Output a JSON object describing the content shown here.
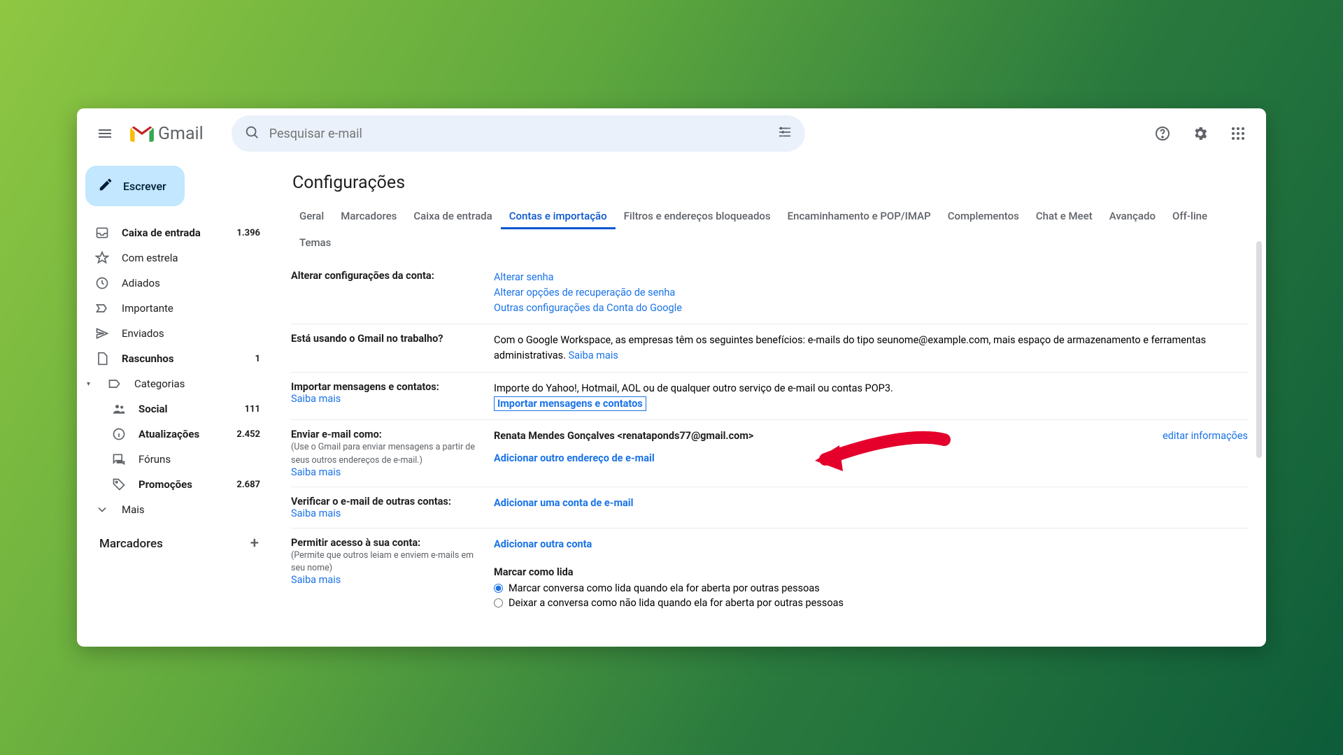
{
  "brand": {
    "name": "Gmail"
  },
  "search": {
    "placeholder": "Pesquisar e-mail"
  },
  "compose": {
    "label": "Escrever"
  },
  "nav": {
    "inbox": {
      "label": "Caixa de entrada",
      "count": "1.396"
    },
    "starred": {
      "label": "Com estrela"
    },
    "snoozed": {
      "label": "Adiados"
    },
    "important": {
      "label": "Importante"
    },
    "sent": {
      "label": "Enviados"
    },
    "drafts": {
      "label": "Rascunhos",
      "count": "1"
    },
    "categories": {
      "label": "Categorias"
    },
    "social": {
      "label": "Social",
      "count": "111"
    },
    "updates": {
      "label": "Atualizações",
      "count": "2.452"
    },
    "forums": {
      "label": "Fóruns"
    },
    "promos": {
      "label": "Promoções",
      "count": "2.687"
    },
    "more": {
      "label": "Mais"
    }
  },
  "labels": {
    "header": "Marcadores"
  },
  "page": {
    "title": "Configurações"
  },
  "tabs": {
    "general": "Geral",
    "labels": "Marcadores",
    "inbox": "Caixa de entrada",
    "accounts": "Contas e importação",
    "filters": "Filtros e endereços bloqueados",
    "forwarding": "Encaminhamento e POP/IMAP",
    "addons": "Complementos",
    "chat": "Chat e Meet",
    "advanced": "Avançado",
    "offline": "Off-line",
    "themes": "Temas"
  },
  "sections": {
    "acct": {
      "title": "Alterar configurações da conta:",
      "l1": "Alterar senha",
      "l2": "Alterar opções de recuperação de senha",
      "l3": "Outras configurações da Conta do Google"
    },
    "work": {
      "title": "Está usando o Gmail no trabalho?",
      "text": "Com o Google Workspace, as empresas têm os seguintes benefícios: e-mails do tipo seunome@example.com, mais espaço de armazenamento e ferramentas administrativas. ",
      "more": "Saiba mais"
    },
    "import": {
      "title": "Importar mensagens e contatos:",
      "more": "Saiba mais",
      "text": "Importe do Yahoo!, Hotmail, AOL ou de qualquer outro serviço de e-mail ou contas POP3.",
      "link": "Importar mensagens e contatos"
    },
    "sendas": {
      "title": "Enviar e-mail como:",
      "sub": "(Use o Gmail para enviar mensagens a partir de seus outros endereços de e-mail.)",
      "more": "Saiba mais",
      "identity": "Renata Mendes Gonçalves <renataponds77@gmail.com>",
      "edit": "editar informações",
      "add": "Adicionar outro endereço de e-mail"
    },
    "check": {
      "title": "Verificar o e-mail de outras contas:",
      "more": "Saiba mais",
      "add": "Adicionar uma conta de e-mail"
    },
    "grant": {
      "title": "Permitir acesso à sua conta:",
      "sub": "(Permite que outros leiam e enviem e-mails em seu nome)",
      "more": "Saiba mais",
      "add": "Adicionar outra conta",
      "markhdr": "Marcar como lida",
      "opt1": "Marcar conversa como lida quando ela for aberta por outras pessoas",
      "opt2": "Deixar a conversa como não lida quando ela for aberta por outras pessoas"
    }
  }
}
